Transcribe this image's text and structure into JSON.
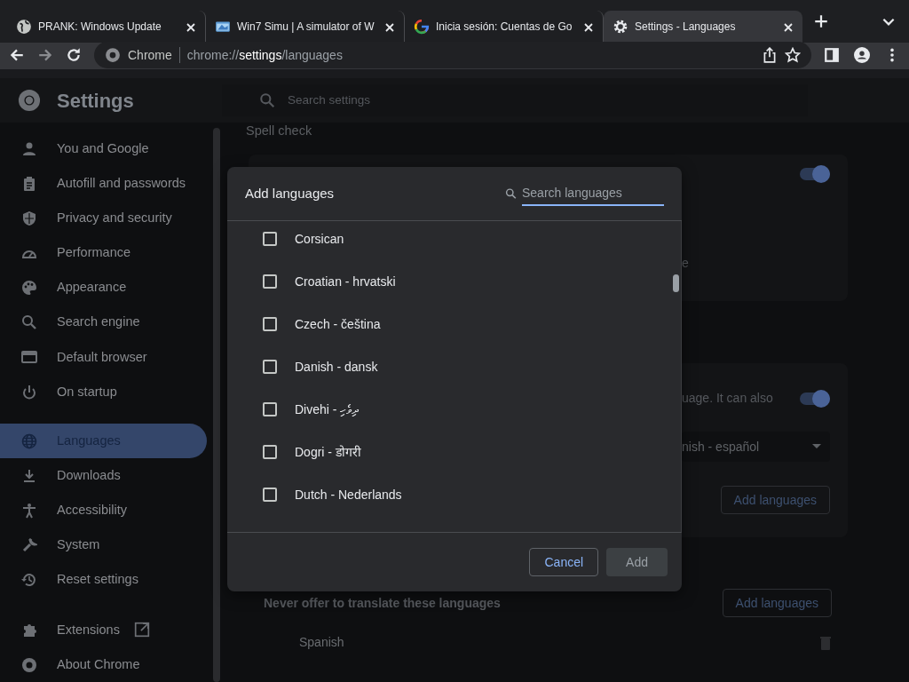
{
  "browser": {
    "tabs": [
      {
        "title": "PRANK: Windows Update",
        "kind": "globe",
        "selected": false
      },
      {
        "title": "Win7 Simu | A simulator of W",
        "kind": "window",
        "selected": false
      },
      {
        "title": "Inicia sesión: Cuentas de Go",
        "kind": "google",
        "selected": false
      },
      {
        "title": "Settings - Languages",
        "kind": "gear",
        "selected": true
      }
    ],
    "address": {
      "site_label": "Chrome",
      "url": "chrome://**settings**/languages"
    }
  },
  "settings": {
    "title": "Settings",
    "search": {
      "placeholder": "Search settings"
    },
    "sidebar": {
      "items": [
        {
          "label": "You and Google",
          "selected": false
        },
        {
          "label": "Autofill and passwords",
          "selected": false
        },
        {
          "label": "Privacy and security",
          "selected": false
        },
        {
          "label": "Performance",
          "selected": false
        },
        {
          "label": "Appearance",
          "selected": false
        },
        {
          "label": "Search engine",
          "selected": false
        },
        {
          "label": "Default browser",
          "selected": false
        },
        {
          "label": "On startup",
          "selected": false
        },
        {
          "label": "Languages",
          "selected": true
        },
        {
          "label": "Downloads",
          "selected": false
        },
        {
          "label": "Accessibility",
          "selected": false
        },
        {
          "label": "System",
          "selected": false
        },
        {
          "label": "Reset settings",
          "selected": false
        },
        {
          "label": "Extensions",
          "selected": false,
          "external": true
        },
        {
          "label": "About Chrome",
          "selected": false
        }
      ]
    },
    "content": {
      "spell_check_heading": "Spell check",
      "spell_toggle_on": true,
      "fragment_1": "e",
      "translate_fragment": "uage. It can also",
      "translate_toggle_on": true,
      "language_select": "nish - español",
      "add_languages_button": "Add languages",
      "never_translate_label": "Never offer to translate these languages",
      "never_translate_button": "Add languages",
      "never_translate_items": [
        "Spanish"
      ]
    }
  },
  "dialog": {
    "title": "Add languages",
    "search": {
      "placeholder": "Search languages"
    },
    "languages": [
      {
        "label": "Corsican",
        "checked": false
      },
      {
        "label": "Croatian - hrvatski",
        "checked": false
      },
      {
        "label": "Czech - čeština",
        "checked": false
      },
      {
        "label": "Danish - dansk",
        "checked": false
      },
      {
        "label": "Divehi - ދިވެހި",
        "checked": false
      },
      {
        "label": "Dogri - डोगरी",
        "checked": false
      },
      {
        "label": "Dutch - Nederlands",
        "checked": false
      }
    ],
    "cancel_button": "Cancel",
    "add_button": {
      "label": "Add",
      "disabled": true
    }
  }
}
